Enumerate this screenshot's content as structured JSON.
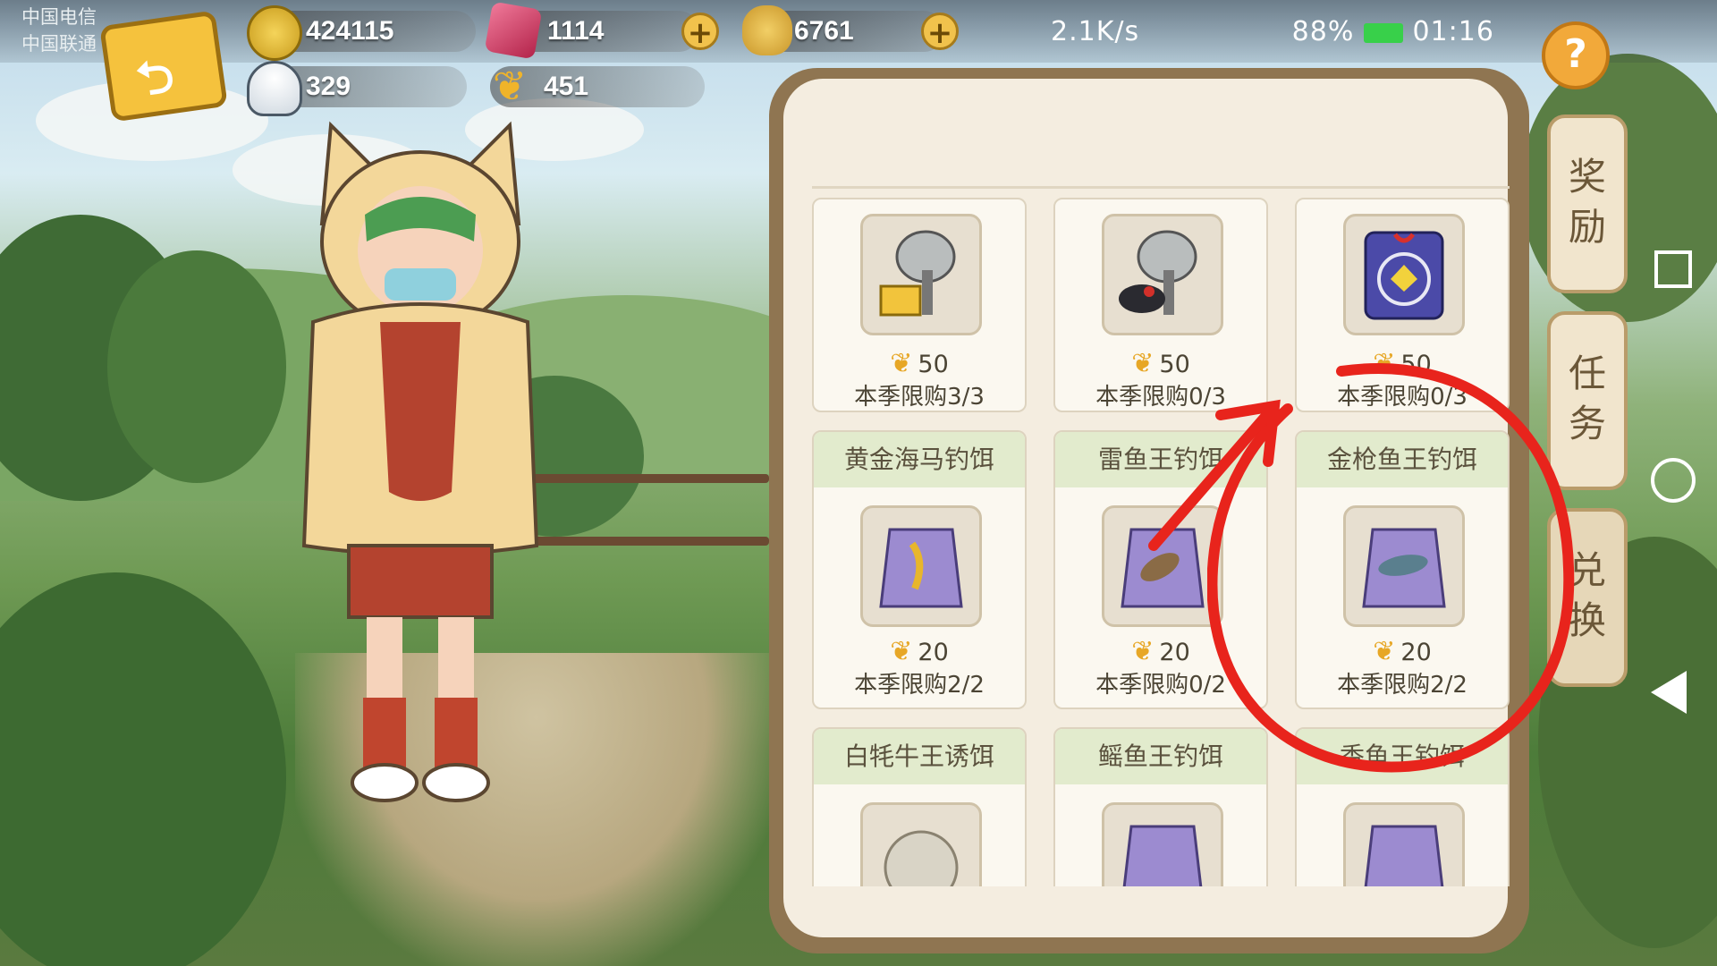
{
  "status_bar": {
    "carrier_1": "中国电信",
    "carrier_2": "中国联通",
    "network_speed": "2.1K/s",
    "battery_percent": "88%",
    "time": "01:16"
  },
  "currencies": {
    "coins": "424115",
    "gems": "1114",
    "shells": "6761",
    "rice_balls": "329",
    "wheat": "451"
  },
  "icons": {
    "back": "back-arrow-icon",
    "coin": "coin-icon",
    "gem": "gem-icon",
    "shell": "shell-icon",
    "rice_ball": "rice-ball-icon",
    "wheat": "wheat-icon",
    "help": "help-icon"
  },
  "help_label": "?",
  "plus_label": "+",
  "shop": {
    "items": [
      {
        "title": "",
        "price": "50",
        "limit": "本季限购3/3"
      },
      {
        "title": "",
        "price": "50",
        "limit": "本季限购0/3"
      },
      {
        "title": "",
        "price": "50",
        "limit": "本季限购0/3"
      },
      {
        "title": "黄金海马钓饵",
        "price": "20",
        "limit": "本季限购2/2"
      },
      {
        "title": "雷鱼王钓饵",
        "price": "20",
        "limit": "本季限购0/2"
      },
      {
        "title": "金枪鱼王钓饵",
        "price": "20",
        "limit": "本季限购2/2"
      },
      {
        "title": "白牦牛王诱饵",
        "price": "",
        "limit": ""
      },
      {
        "title": "鳐鱼王钓饵",
        "price": "",
        "limit": ""
      },
      {
        "title": "香鱼王钓饵",
        "price": "",
        "limit": ""
      }
    ]
  },
  "side_tabs": [
    {
      "label": "奖励"
    },
    {
      "label": "任务"
    },
    {
      "label": "兑换"
    }
  ],
  "colors": {
    "annotation": "#e8241c",
    "panel_border": "#8f7551",
    "card_header": "#e2ebcd"
  }
}
